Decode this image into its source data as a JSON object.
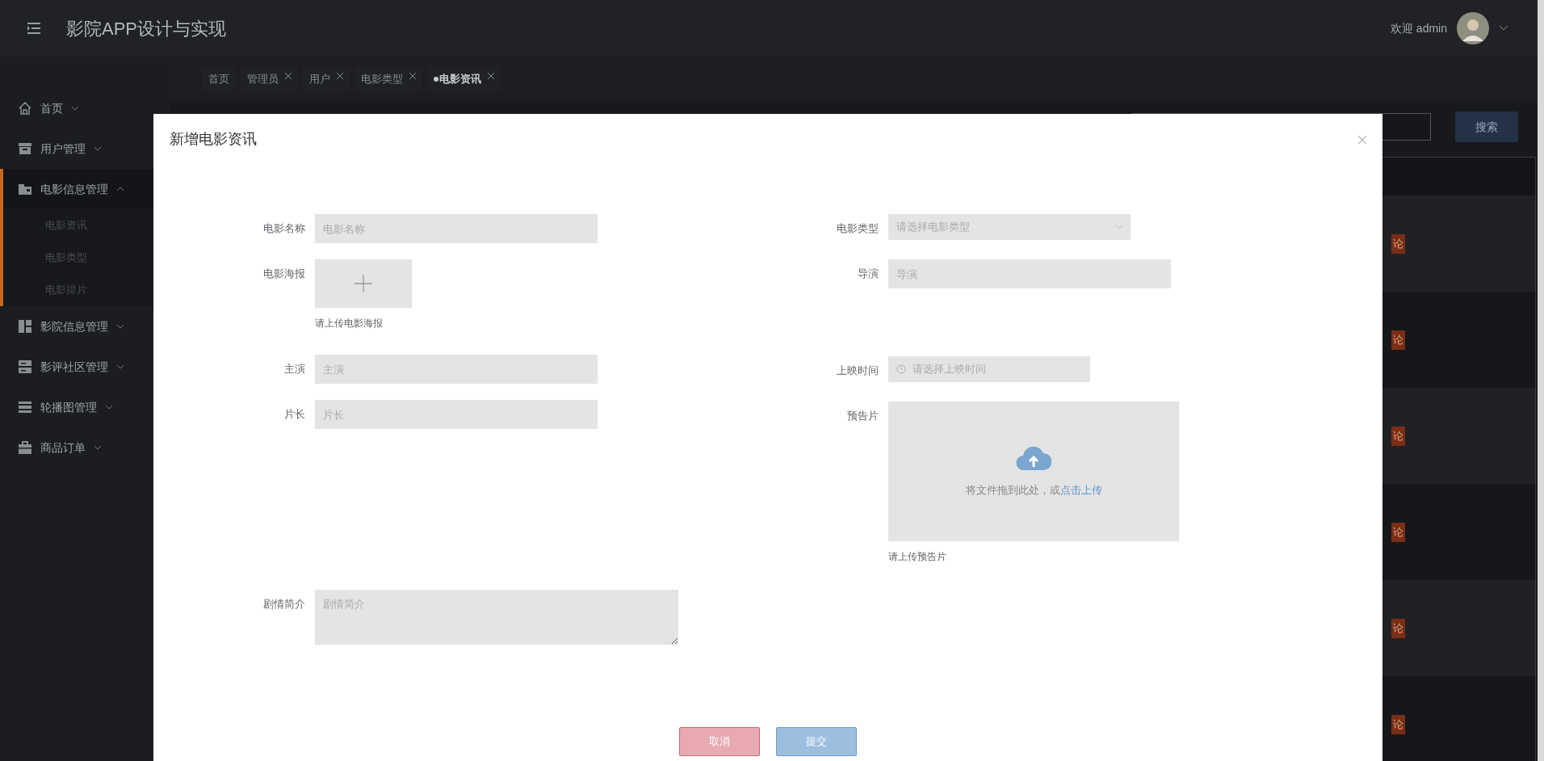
{
  "header": {
    "title": "影院APP设计与实现",
    "welcome": "欢迎 admin"
  },
  "sidebar": {
    "items": [
      {
        "label": "首页",
        "expanded": false
      },
      {
        "label": "用户管理",
        "expanded": false
      },
      {
        "label": "电影信息管理",
        "expanded": true,
        "children": [
          {
            "label": "电影资讯"
          },
          {
            "label": "电影类型"
          },
          {
            "label": "电影排片"
          }
        ]
      },
      {
        "label": "影院信息管理",
        "expanded": false
      },
      {
        "label": "影评社区管理",
        "expanded": false
      },
      {
        "label": "轮播图管理",
        "expanded": false
      },
      {
        "label": "商品订单",
        "expanded": false
      }
    ]
  },
  "tabs": [
    {
      "label": "首页",
      "closable": false,
      "selected": false
    },
    {
      "label": "管理员",
      "closable": true,
      "selected": false
    },
    {
      "label": "用户",
      "closable": true,
      "selected": false
    },
    {
      "label": "电影类型",
      "closable": true,
      "selected": false
    },
    {
      "label": "电影资讯",
      "closable": true,
      "selected": true
    }
  ],
  "search": {
    "button": "搜索"
  },
  "table": {
    "rows": [
      {
        "action": "论"
      },
      {
        "action": "论"
      },
      {
        "action": "论"
      },
      {
        "action": "论"
      },
      {
        "action": "论"
      },
      {
        "action": "论"
      }
    ]
  },
  "modal": {
    "title": "新增电影资讯",
    "left_fields": [
      {
        "kind": "text",
        "label": "电影名称",
        "placeholder": "电影名称"
      },
      {
        "kind": "image",
        "label": "电影海报",
        "hint": "请上传电影海报"
      },
      {
        "kind": "text",
        "label": "主演",
        "placeholder": "主演"
      },
      {
        "kind": "text",
        "label": "片长",
        "placeholder": "片长"
      },
      {
        "kind": "textarea",
        "label": "剧情简介",
        "placeholder": "剧情简介"
      }
    ],
    "right_fields": [
      {
        "kind": "select",
        "label": "电影类型",
        "placeholder": "请选择电影类型"
      },
      {
        "kind": "text",
        "label": "导演",
        "placeholder": "导演"
      },
      {
        "kind": "date",
        "label": "上映时间",
        "placeholder": "请选择上映时间"
      },
      {
        "kind": "file",
        "label": "预告片",
        "text": "将文件拖到此处，或",
        "link": "点击上传",
        "hint": "请上传预告片"
      }
    ],
    "buttons": [
      {
        "label": "取消",
        "kind": "cancel"
      },
      {
        "label": "提交",
        "kind": "submit"
      }
    ]
  }
}
